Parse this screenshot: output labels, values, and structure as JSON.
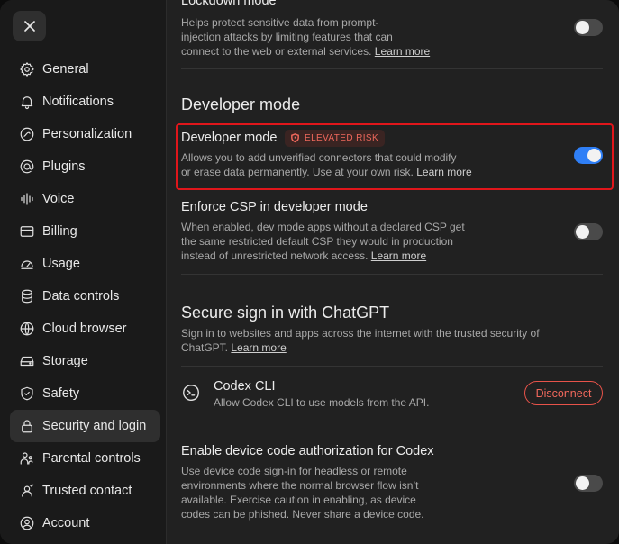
{
  "sidebar": {
    "close_icon": "close-icon",
    "items": [
      {
        "label": "General",
        "icon": "gear-icon"
      },
      {
        "label": "Notifications",
        "icon": "bell-icon"
      },
      {
        "label": "Personalization",
        "icon": "personalization-icon"
      },
      {
        "label": "Plugins",
        "icon": "at-sign-icon"
      },
      {
        "label": "Voice",
        "icon": "waveform-icon"
      },
      {
        "label": "Billing",
        "icon": "credit-card-icon"
      },
      {
        "label": "Usage",
        "icon": "usage-icon"
      },
      {
        "label": "Data controls",
        "icon": "database-icon"
      },
      {
        "label": "Cloud browser",
        "icon": "globe-icon"
      },
      {
        "label": "Storage",
        "icon": "storage-icon"
      },
      {
        "label": "Safety",
        "icon": "shield-icon"
      },
      {
        "label": "Security and login",
        "icon": "lock-icon",
        "active": true
      },
      {
        "label": "Parental controls",
        "icon": "parent-icon"
      },
      {
        "label": "Trusted contact",
        "icon": "contact-icon"
      },
      {
        "label": "Account",
        "icon": "account-icon"
      }
    ]
  },
  "main": {
    "lockdown": {
      "title": "Lockdown mode",
      "desc_line1": "Helps protect sensitive data from prompt-",
      "desc_line2": "injection attacks by limiting features that can",
      "desc_line3": "connect to the web or external services.",
      "link": "Learn more",
      "enabled": false
    },
    "developer_section_title": "Developer mode",
    "developer_mode": {
      "title": "Developer mode",
      "badge": "ELEVATED RISK",
      "desc_line1": "Allows you to add unverified connectors that could modify",
      "desc_line2": "or erase data permanently. Use at your own risk.",
      "link": "Learn more",
      "enabled": true
    },
    "csp": {
      "title": "Enforce CSP in developer mode",
      "desc_line1": "When enabled, dev mode apps without a declared CSP get",
      "desc_line2": "the same restricted default CSP they would in production",
      "desc_line3": "instead of unrestricted network access.",
      "link": "Learn more",
      "enabled": false
    },
    "secure_signin": {
      "title": "Secure sign in with ChatGPT",
      "desc_line1": "Sign in to websites and apps across the internet with the trusted security of",
      "desc_line2": "ChatGPT.",
      "link": "Learn more"
    },
    "codex_cli": {
      "title": "Codex CLI",
      "desc": "Allow Codex CLI to use models from the API.",
      "button": "Disconnect",
      "icon": "terminal-icon"
    },
    "device_code": {
      "title": "Enable device code authorization for Codex",
      "desc_line1": "Use device code sign-in for headless or remote",
      "desc_line2": "environments where the normal browser flow isn’t",
      "desc_line3": "available. Exercise caution in enabling, as device",
      "desc_line4": "codes can be phished. Never share a device code.",
      "enabled": false
    }
  },
  "colors": {
    "accent_toggle_on": "#2f7ff6",
    "danger": "#f0685c",
    "highlight_border": "#e0161b"
  }
}
